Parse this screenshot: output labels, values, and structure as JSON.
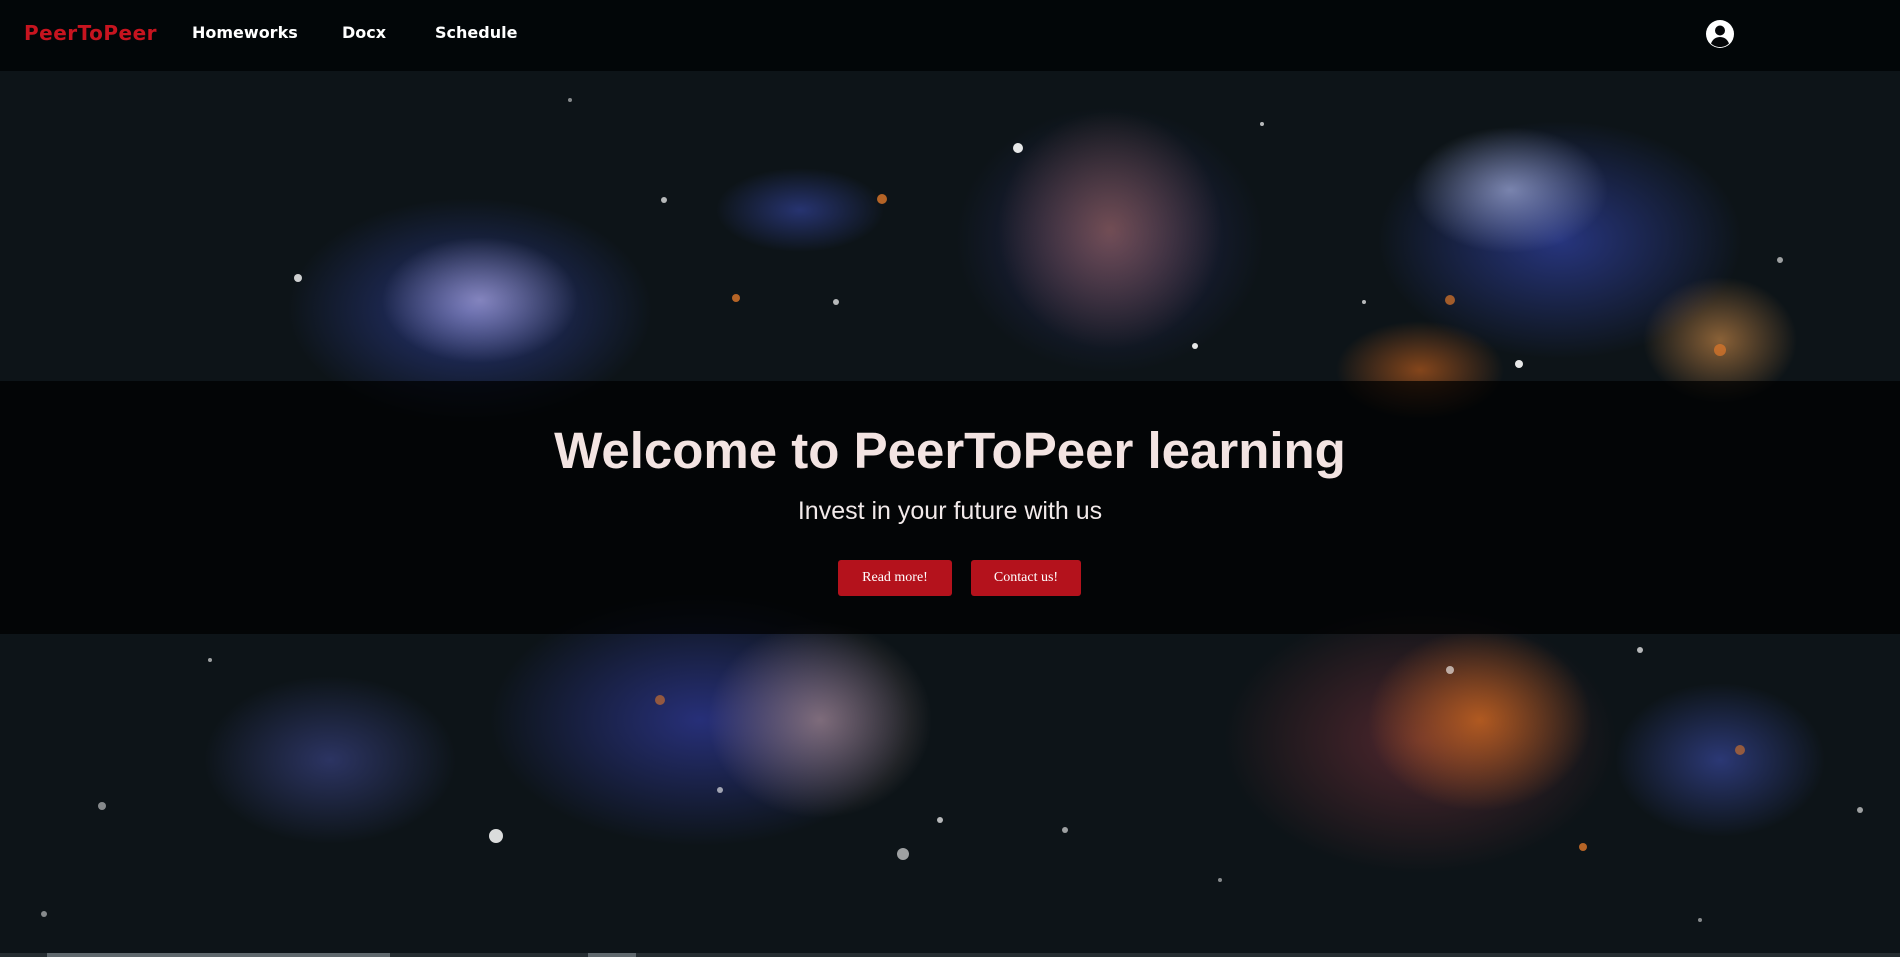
{
  "navbar": {
    "brand": "PeerToPeer",
    "links": [
      {
        "label": "Homeworks"
      },
      {
        "label": "Docx"
      },
      {
        "label": "Schedule"
      }
    ],
    "user_icon": "user-circle-icon"
  },
  "hero": {
    "title": "Welcome to PeerToPeer learning",
    "subtitle": "Invest in your future with us",
    "buttons": {
      "read_more": "Read more!",
      "contact": "Contact us!"
    },
    "background": "space-nebula-image"
  },
  "colors": {
    "brand": "#c7141f",
    "button": "#b4121c",
    "navbar_bg": "#020507",
    "title_text": "#f3e4e2"
  }
}
